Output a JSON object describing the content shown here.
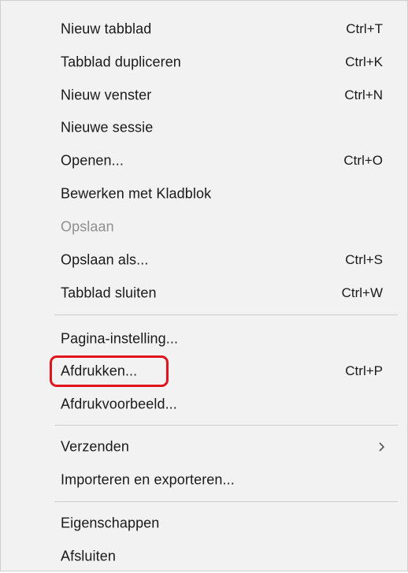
{
  "menu": {
    "items": [
      {
        "label": "Nieuw tabblad",
        "shortcut": "Ctrl+T"
      },
      {
        "label": "Tabblad dupliceren",
        "shortcut": "Ctrl+K"
      },
      {
        "label": "Nieuw venster",
        "shortcut": "Ctrl+N"
      },
      {
        "label": "Nieuwe sessie",
        "shortcut": ""
      },
      {
        "label": "Openen...",
        "shortcut": "Ctrl+O"
      },
      {
        "label": "Bewerken met Kladblok",
        "shortcut": ""
      },
      {
        "label": "Opslaan",
        "shortcut": "",
        "disabled": true
      },
      {
        "label": "Opslaan als...",
        "shortcut": "Ctrl+S"
      },
      {
        "label": "Tabblad sluiten",
        "shortcut": "Ctrl+W"
      },
      {
        "label": "Pagina-instelling...",
        "shortcut": ""
      },
      {
        "label": "Afdrukken...",
        "shortcut": "Ctrl+P",
        "highlighted": true
      },
      {
        "label": "Afdrukvoorbeeld...",
        "shortcut": ""
      },
      {
        "label": "Verzenden",
        "shortcut": "",
        "submenu_icon": "chevron-right-icon"
      },
      {
        "label": "Importeren en exporteren...",
        "shortcut": ""
      },
      {
        "label": "Eigenschappen",
        "shortcut": ""
      },
      {
        "label": "Afsluiten",
        "shortcut": ""
      }
    ]
  },
  "colors": {
    "menu_background": "#f2f2f2",
    "highlight_border": "#e0141c",
    "disabled_text": "#8f8f8f"
  }
}
